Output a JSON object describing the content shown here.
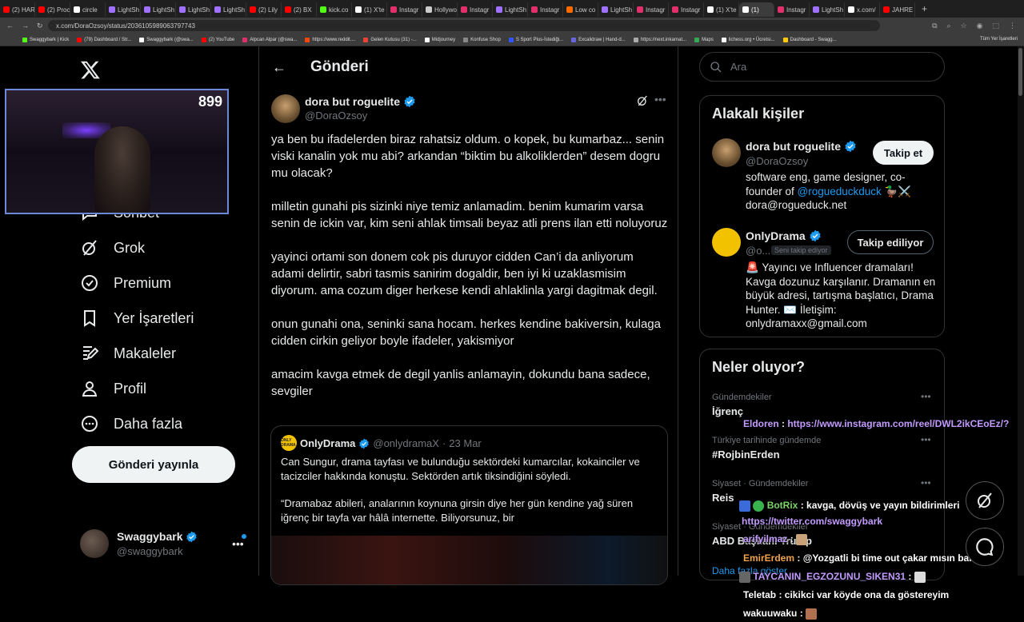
{
  "browser": {
    "tabs": [
      {
        "label": "(2) HAR",
        "color": "#ff0000"
      },
      {
        "label": "(2) Proc",
        "color": "#ff0000"
      },
      {
        "label": "circle",
        "color": "#ffffff"
      },
      {
        "label": "LightSh",
        "color": "#a070ff"
      },
      {
        "label": "LightSh",
        "color": "#a070ff"
      },
      {
        "label": "LightSh",
        "color": "#a070ff"
      },
      {
        "label": "LightSh",
        "color": "#a070ff"
      },
      {
        "label": "(2) Lily",
        "color": "#ff0000"
      },
      {
        "label": "(2) BX",
        "color": "#ff0000"
      },
      {
        "label": "kick.co",
        "color": "#53fc18"
      },
      {
        "label": "(1) X'te",
        "color": "#ffffff"
      },
      {
        "label": "Instagr",
        "color": "#e1306c"
      },
      {
        "label": "Hollywo",
        "color": "#cccccc"
      },
      {
        "label": "Instagr",
        "color": "#e1306c"
      },
      {
        "label": "LightSh",
        "color": "#a070ff"
      },
      {
        "label": "Instagr",
        "color": "#e1306c"
      },
      {
        "label": "Low co",
        "color": "#ff6a00"
      },
      {
        "label": "LightSh",
        "color": "#a070ff"
      },
      {
        "label": "Instagr",
        "color": "#e1306c"
      },
      {
        "label": "Instagr",
        "color": "#e1306c"
      },
      {
        "label": "(1) X'te",
        "color": "#ffffff"
      },
      {
        "label": "(1)",
        "color": "#ffffff"
      },
      {
        "label": "Instagr",
        "color": "#e1306c"
      },
      {
        "label": "LightSh",
        "color": "#a070ff"
      },
      {
        "label": "x.com/",
        "color": "#ffffff"
      },
      {
        "label": "JAHRE",
        "color": "#ff0000"
      }
    ],
    "active_tab_index": 21,
    "url": "x.com/DoraOzsoy/status/2036105989063797743",
    "bookmarks": [
      {
        "label": "Swaggybark | Kick",
        "color": "#53fc18"
      },
      {
        "label": "(79) Dashboard / Str...",
        "color": "#ff0000"
      },
      {
        "label": "Swaggybark (@swa...",
        "color": "#ffffff"
      },
      {
        "label": "(2) YouTube",
        "color": "#ff0000"
      },
      {
        "label": "Alpcan Alpar (@swa...",
        "color": "#e1306c"
      },
      {
        "label": "https://www.reddit....",
        "color": "#ff4500"
      },
      {
        "label": "Gelen Kutusu (31) -...",
        "color": "#ea4335"
      },
      {
        "label": "Midjourney",
        "color": "#ffffff"
      },
      {
        "label": "Konfuse Shop",
        "color": "#888888"
      },
      {
        "label": "S Sport Plus-İstediği...",
        "color": "#3355ff"
      },
      {
        "label": "Excalidraw | Hand-d...",
        "color": "#6965db"
      },
      {
        "label": "https://next.inkarnat...",
        "color": "#aaaaaa"
      },
      {
        "label": "Maps",
        "color": "#34a853"
      },
      {
        "label": "lichess.org • Ücretsi...",
        "color": "#ffffff"
      },
      {
        "label": "Dashboard - Swagg...",
        "color": "#ffcc00"
      }
    ],
    "bookmarks_right": "Tüm Yer İşaretleri"
  },
  "sidebar": {
    "items": [
      {
        "label": "Sohbet",
        "icon": "chat-icon"
      },
      {
        "label": "Grok",
        "icon": "grok-icon"
      },
      {
        "label": "Premium",
        "icon": "premium-icon"
      },
      {
        "label": "Yer İşaretleri",
        "icon": "bookmark-icon"
      },
      {
        "label": "Makaleler",
        "icon": "articles-icon"
      },
      {
        "label": "Profil",
        "icon": "profile-icon"
      },
      {
        "label": "Daha fazla",
        "icon": "more-icon"
      }
    ],
    "post_button": "Gönderi yayınla",
    "profile": {
      "name": "Swaggybark",
      "handle": "@swaggybark"
    }
  },
  "webcam": {
    "count": "899"
  },
  "main": {
    "title": "Gönderi",
    "tweet": {
      "name": "dora but roguelite",
      "handle": "@DoraOzsoy",
      "paragraphs": [
        "ya ben bu ifadelerden biraz rahatsiz oldum. o kopek, bu kumarbaz... senin viski kanalin yok mu abi? arkandan “biktim bu alkoliklerden” desem dogru mu olacak?",
        "milletin gunahi pis sizinki niye temiz anlamadim. benim kumarim varsa senin de ickin var, kim seni ahlak timsali beyaz atli prens ilan etti noluyoruz",
        "yayinci ortami son donem cok pis duruyor cidden Can’i da anliyorum adami delirtir, sabri tasmis sanirim dogaldir, ben iyi ki uzaklasmisim diyorum. ama cozum diger herkese kendi ahlaklinla yargi dagitmak degil.",
        "onun gunahi ona, seninki sana hocam. herkes kendine bakiversin, kulaga cidden cirkin geliyor boyle ifadeler, yakismiyor",
        "amacim kavga etmek de degil yanlis anlamayin, dokundu bana sadece, sevgiler"
      ]
    },
    "quote": {
      "name": "OnlyDrama",
      "handle": "@onlydramaX",
      "date": "23 Mar",
      "avatar_text": "ONLY DRAMA",
      "paragraphs": [
        "Can Sungur, drama tayfası ve bulunduğu sektördeki kumarcılar, kokainciler ve tacizciler hakkında konuştu. Sektörden artık tiksindiğini söyledi.",
        "“Dramabaz abileri, analarının koynuna girsin diye her gün kendine yağ süren iğrenç bir tayfa var hâlâ internette. Biliyorsunuz, bir"
      ]
    }
  },
  "right": {
    "search_placeholder": "Ara",
    "related": {
      "title": "Alakalı kişiler",
      "people": [
        {
          "name": "dora but roguelite",
          "handle": "@DoraOzsoy",
          "button": "Takip et",
          "bio_pre": "software eng, game designer, co-founder of ",
          "bio_link": "@rogueduckduck",
          "bio_post": " 🦆⚔️",
          "bio_line2": "dora@rogueduck.net"
        },
        {
          "name": "OnlyDrama",
          "handle": "@o...",
          "follows_you": "Seni takip ediyor",
          "button": "Takip ediliyor",
          "bio": "🚨 Yayıncı ve Influencer dramaları! Kavga dozunuz karşılanır. Dramanın en büyük adresi, tartışma başlatıcı, Drama Hunter. ✉️ İletişim: onlydramaxx@gmail.com"
        }
      ]
    },
    "trends": {
      "title": "Neler oluyor?",
      "items": [
        {
          "context": "Gündemdekiler",
          "name": "İğrenç"
        },
        {
          "context": "Türkiye tarihinde gündemde",
          "name": "#RojbinErden"
        },
        {
          "context": "Siyaset · Gündemdekiler",
          "name": "Reis"
        },
        {
          "context": "Siyaset · Gündemdekiler",
          "name": "ABD Başkanı Trump"
        }
      ],
      "show_more": "Daha fazla göster"
    }
  },
  "chat": [
    {
      "user": "Eldoren",
      "user_color": "#c39bff",
      "text": "https://www.instagram.com/reel/DWL2ikCEoEz/?",
      "text_color": "#c39bff"
    },
    {
      "user": "BotRix",
      "user_color": "#7cd36a",
      "text": "kavga, dövüş ve yayın bildirimleri",
      "text_color": "#ffffff"
    },
    {
      "user": "",
      "user_color": "#c39bff",
      "text": "https://twitter.com/swaggybark",
      "text_color": "#c39bff"
    },
    {
      "user": "arifyilmaz",
      "user_color": "#c39bff",
      "text": "",
      "text_color": "#ffffff"
    },
    {
      "user": "EmirErdem",
      "user_color": "#f0a24b",
      "text": "@Yozgatli bi time out çakar mısın bana",
      "text_color": "#ffffff"
    },
    {
      "user": "TAYCANIN_EGZOZUNU_SIKEN31",
      "user_color": "#c39bff",
      "text": "",
      "text_color": "#ffffff"
    },
    {
      "user": "Teletab",
      "user_color": "#ffffff",
      "text": "cikikci var köyde ona da göstereyim",
      "text_color": "#ffffff"
    },
    {
      "user": "wakuuwaku",
      "user_color": "#ffffff",
      "text": "",
      "text_color": "#ffffff"
    }
  ]
}
